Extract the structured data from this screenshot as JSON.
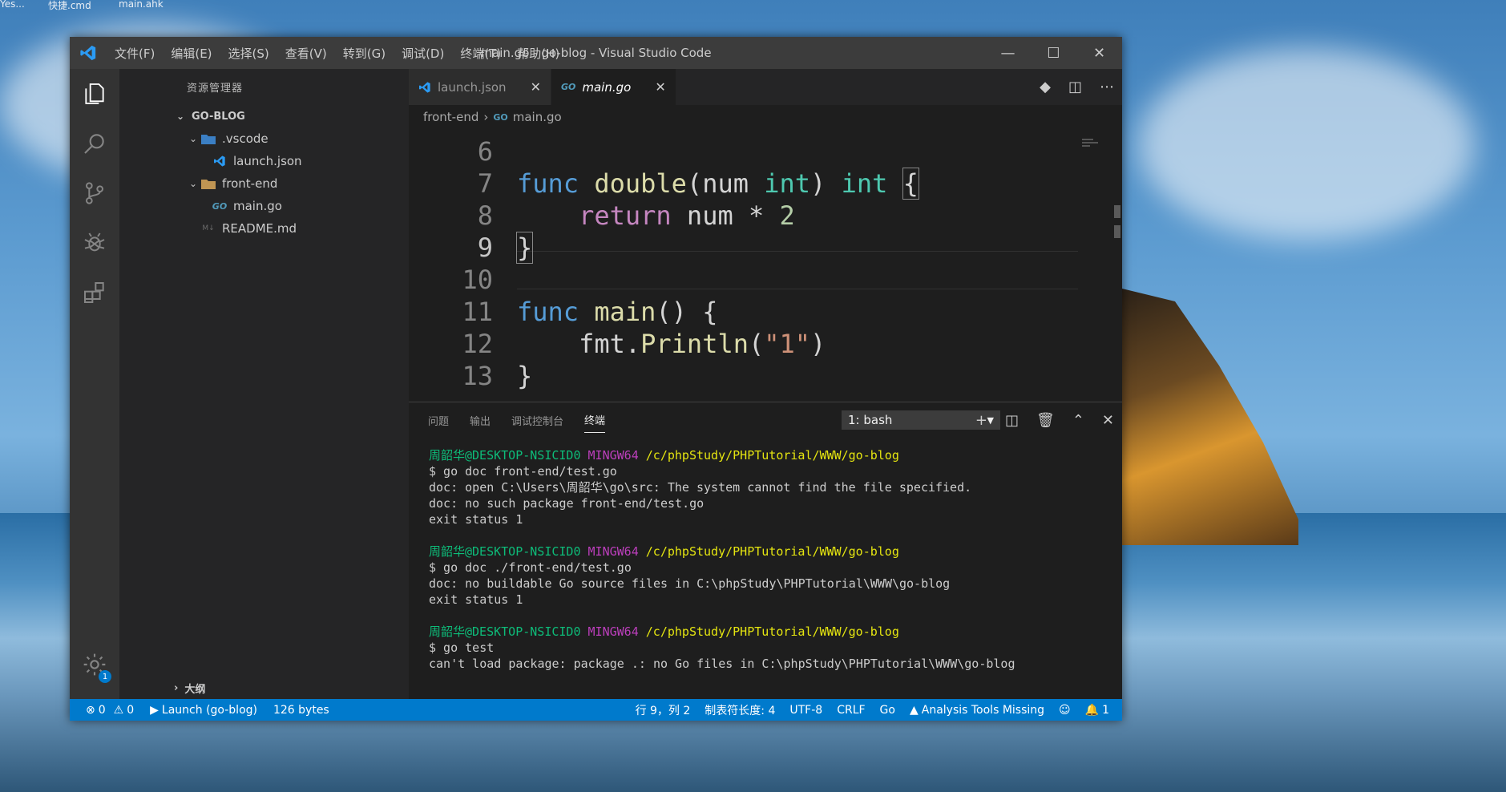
{
  "desktop": {
    "labels": [
      "Yes...",
      "快捷.cmd",
      "main.ahk"
    ]
  },
  "window": {
    "title": "main.go - go-blog - Visual Studio Code",
    "menu": [
      "文件(F)",
      "编辑(E)",
      "选择(S)",
      "查看(V)",
      "转到(G)",
      "调试(D)",
      "终端(T)",
      "帮助(H)"
    ],
    "controls": {
      "minimize": "—",
      "maximize": "☐",
      "close": "✕"
    }
  },
  "activity_bar": {
    "items": [
      "explorer-icon",
      "search-icon",
      "source-control-icon",
      "debug-icon",
      "extensions-icon"
    ],
    "gear_badge": "1"
  },
  "sidebar": {
    "title": "资源管理器",
    "tree": {
      "root": "GO-BLOG",
      "vscode_folder": ".vscode",
      "launch_json": "launch.json",
      "frontend_folder": "front-end",
      "main_go": "main.go",
      "readme": "README.md"
    },
    "outline": "大纲"
  },
  "tabs": [
    {
      "label": "launch.json",
      "close": "✕"
    },
    {
      "label": "main.go",
      "close": "✕"
    }
  ],
  "breadcrumb": {
    "folder": "front-end",
    "sep": "›",
    "file": "main.go"
  },
  "code": {
    "lines": [
      {
        "n": "6"
      },
      {
        "n": "7",
        "kw": "func",
        "fn": "double",
        "p1": "(",
        "param": "num",
        "ty1": "int",
        "p2": ")",
        "ty2": "int",
        "brace": "{"
      },
      {
        "n": "8",
        "ctl": "return",
        "var": "num",
        "op": "*",
        "num": "2"
      },
      {
        "n": "9",
        "brace": "}"
      },
      {
        "n": "10"
      },
      {
        "n": "11",
        "kw": "func",
        "fn": "main",
        "rest": "() {"
      },
      {
        "n": "12",
        "pkg": "fmt.",
        "fn": "Println",
        "p1": "(",
        "str": "\"1\"",
        "p2": ")"
      },
      {
        "n": "13",
        "brace": "}"
      }
    ]
  },
  "panel": {
    "tabs": [
      "问题",
      "输出",
      "调试控制台",
      "终端"
    ],
    "terminal_select": "1: bash",
    "terminal": [
      {
        "type": "prompt",
        "user": "周韶华@DESKTOP-NSICID0",
        "env": "MINGW64",
        "path": "/c/phpStudy/PHPTutorial/WWW/go-blog"
      },
      {
        "type": "text",
        "text": "$ go doc front-end/test.go"
      },
      {
        "type": "text",
        "text": "doc: open C:\\Users\\周韶华\\go\\src: The system cannot find the file specified."
      },
      {
        "type": "text",
        "text": "doc: no such package front-end/test.go"
      },
      {
        "type": "text",
        "text": "exit status 1"
      },
      {
        "type": "gap"
      },
      {
        "type": "prompt",
        "user": "周韶华@DESKTOP-NSICID0",
        "env": "MINGW64",
        "path": "/c/phpStudy/PHPTutorial/WWW/go-blog"
      },
      {
        "type": "text",
        "text": "$ go doc ./front-end/test.go"
      },
      {
        "type": "text",
        "text": "doc: no buildable Go source files in C:\\phpStudy\\PHPTutorial\\WWW\\go-blog"
      },
      {
        "type": "text",
        "text": "exit status 1"
      },
      {
        "type": "gap"
      },
      {
        "type": "prompt",
        "user": "周韶华@DESKTOP-NSICID0",
        "env": "MINGW64",
        "path": "/c/phpStudy/PHPTutorial/WWW/go-blog"
      },
      {
        "type": "text",
        "text": "$ go test"
      },
      {
        "type": "text",
        "text": "can't load package: package .: no Go files in C:\\phpStudy\\PHPTutorial\\WWW\\go-blog"
      }
    ]
  },
  "statusbar": {
    "errors": "0",
    "warnings": "0",
    "launch": "Launch (go-blog)",
    "size": "126 bytes",
    "position": "行 9，列 2",
    "tab_size": "制表符长度: 4",
    "encoding": "UTF-8",
    "eol": "CRLF",
    "language": "Go",
    "analysis": "Analysis Tools Missing",
    "notifications": "1"
  },
  "colors": {
    "accent": "#007acc",
    "keyword": "#569cd6",
    "function": "#dcdcaa",
    "type": "#4ec9b0",
    "control": "#c586c0"
  }
}
